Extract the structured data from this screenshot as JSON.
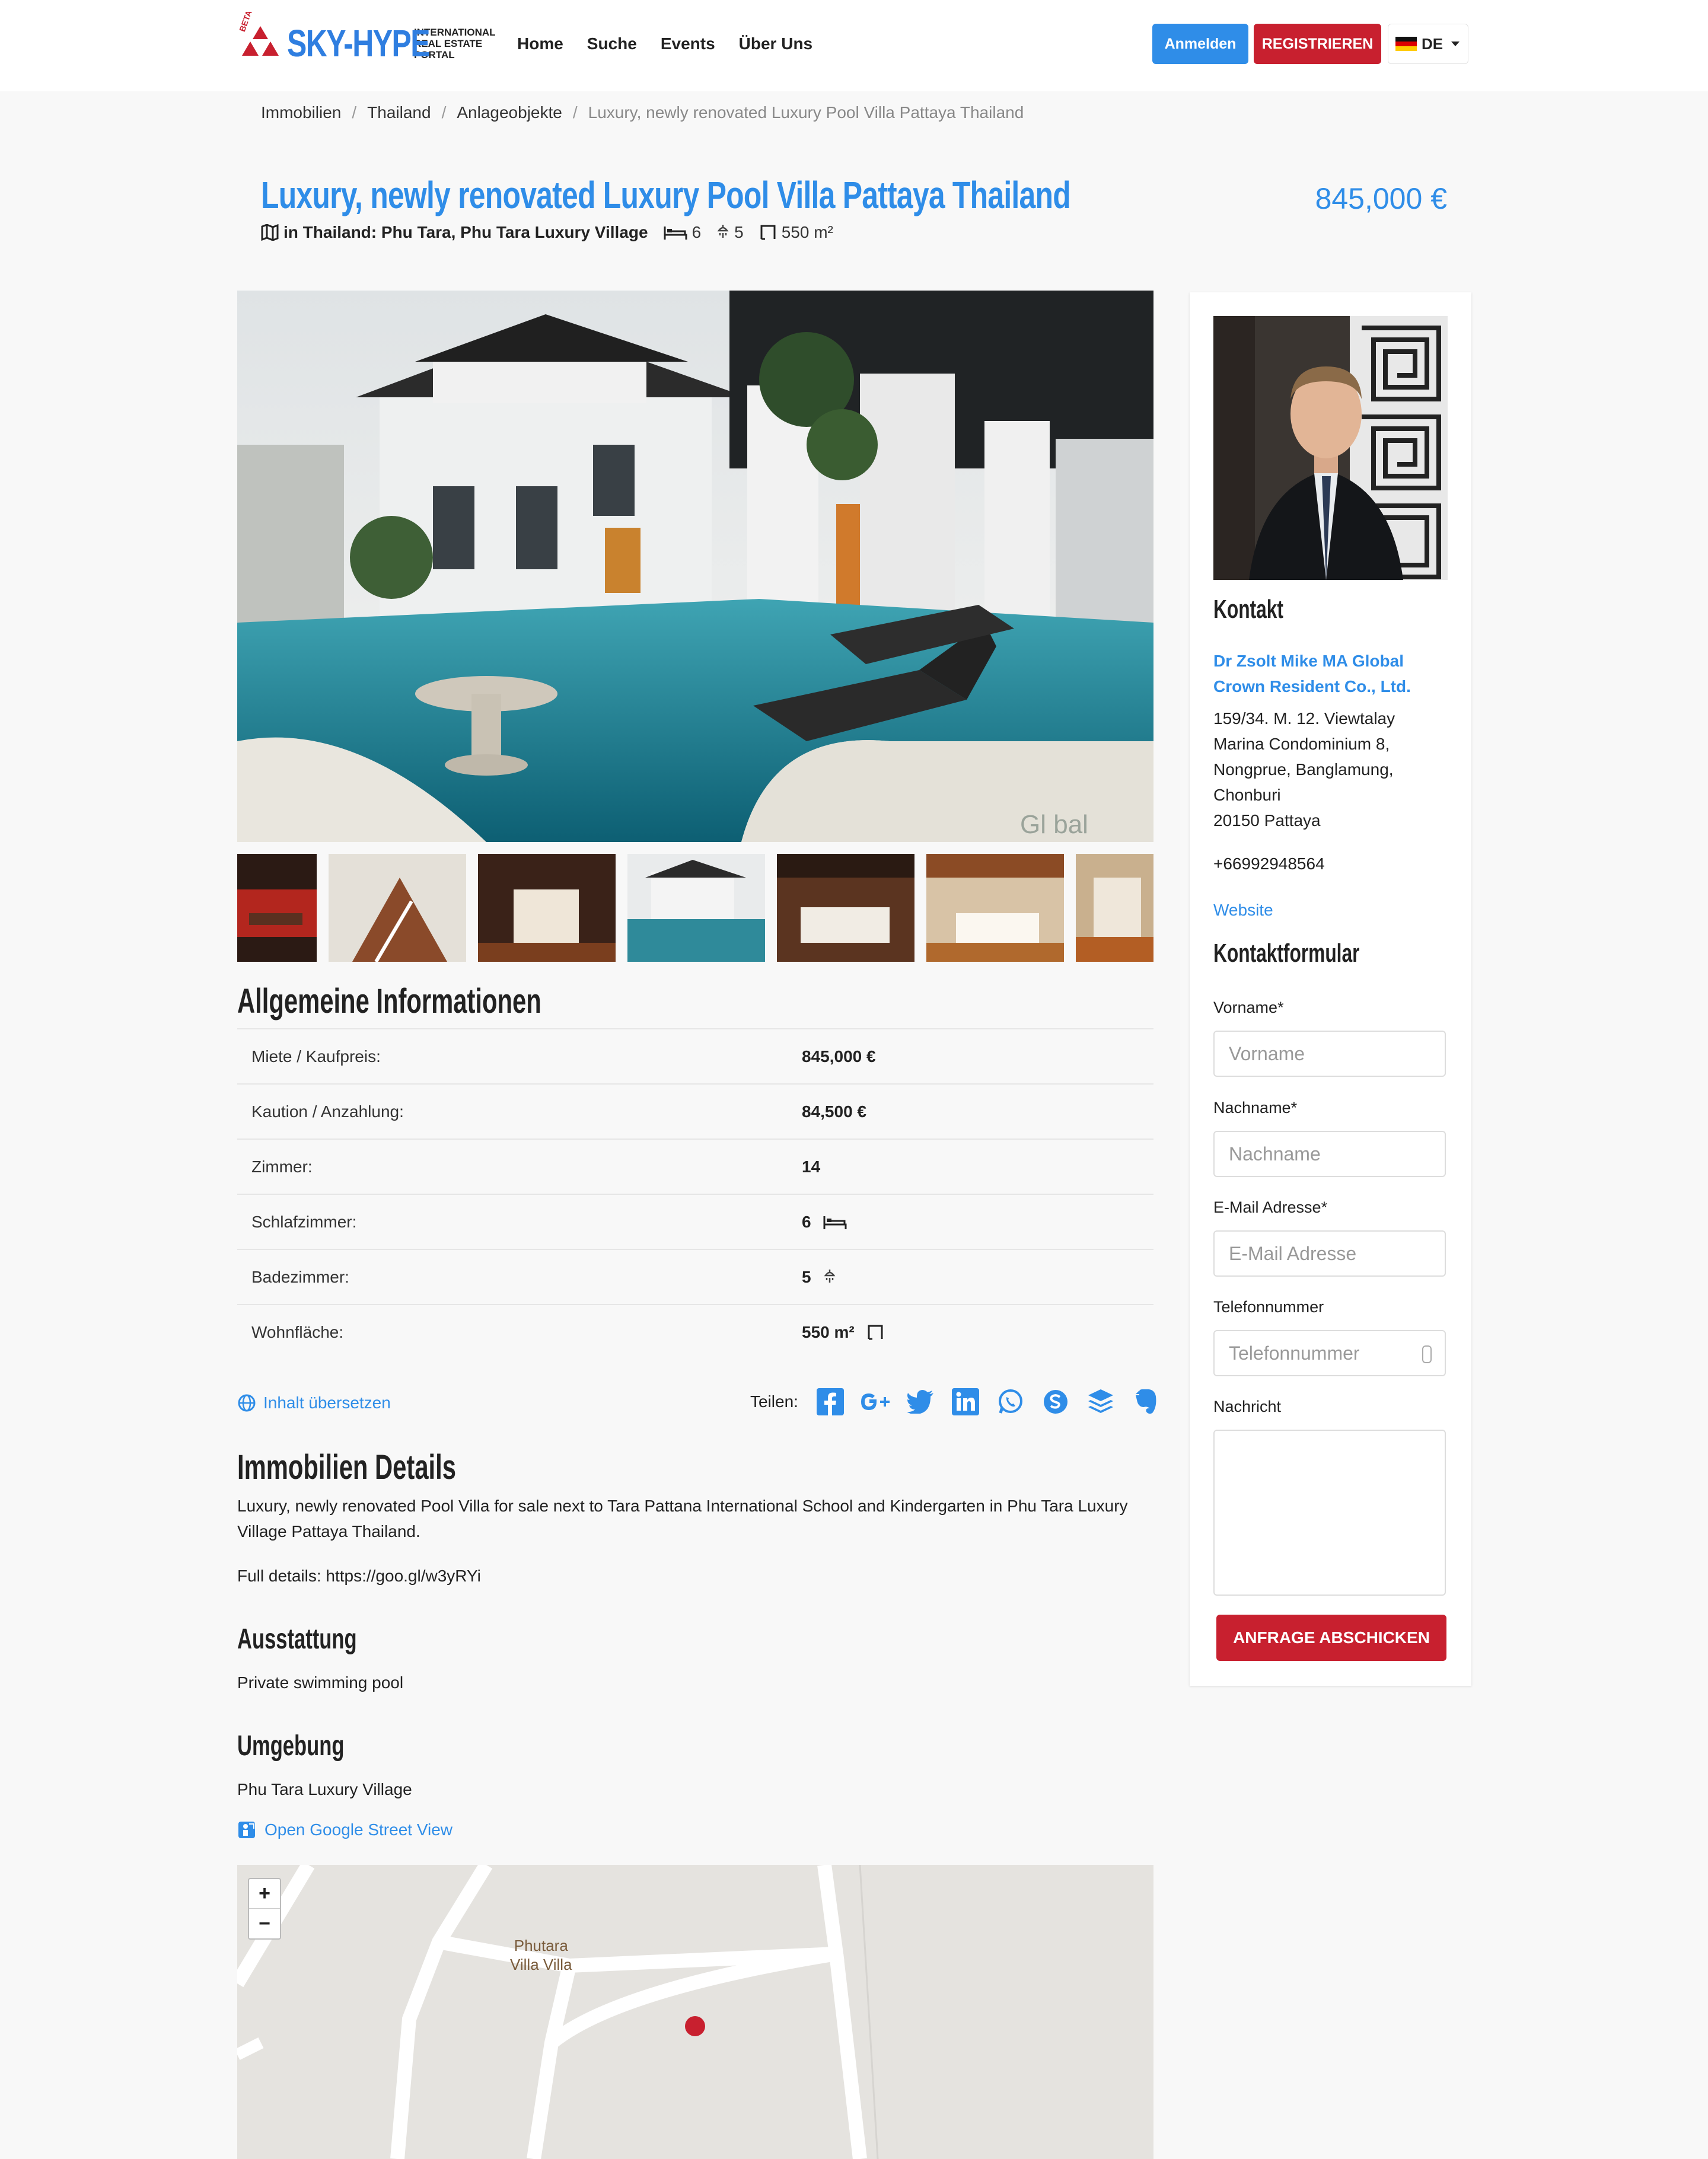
{
  "header": {
    "logo_badge": "BETA",
    "logo_name": "SKY-HYPE",
    "logo_sub": "INTERNATIONAL REAL ESTATE PORTAL",
    "nav": [
      "Home",
      "Suche",
      "Events",
      "Über Uns"
    ],
    "login": "Anmelden",
    "register": "REGISTRIEREN",
    "language": "DE"
  },
  "breadcrumb": [
    "Immobilien",
    "Thailand",
    "Anlageobjekte",
    "Luxury, newly renovated Luxury Pool Villa Pattaya Thailand"
  ],
  "listing": {
    "title": "Luxury, newly renovated Luxury Pool Villa Pattaya Thailand",
    "location": "in Thailand: Phu Tara, Phu Tara Luxury Village",
    "bedrooms": "6",
    "bathrooms": "5",
    "area": "550 m²",
    "price": "845,000 €",
    "photo_watermark": "Gl bal"
  },
  "general": {
    "heading": "Allgemeine Informationen",
    "rows": [
      {
        "label": "Miete / Kaufpreis:",
        "value": "845,000 €",
        "icon": ""
      },
      {
        "label": "Kaution / Anzahlung:",
        "value": "84,500 €",
        "icon": ""
      },
      {
        "label": "Zimmer:",
        "value": "14",
        "icon": ""
      },
      {
        "label": "Schlafzimmer:",
        "value": "6",
        "icon": "bed-icon"
      },
      {
        "label": "Badezimmer:",
        "value": "5",
        "icon": "shower-icon"
      },
      {
        "label": "Wohnfläche:",
        "value": "550 m²",
        "icon": "area-icon"
      }
    ]
  },
  "translate_label": "Inhalt übersetzen",
  "share": {
    "label": "Teilen:",
    "icons": [
      "facebook-icon",
      "google-plus-icon",
      "twitter-icon",
      "linkedin-icon",
      "whatsapp-icon",
      "skype-icon",
      "buffer-icon",
      "evernote-icon"
    ]
  },
  "details": {
    "heading": "Immobilien Details",
    "text": "Luxury, newly renovated Pool Villa for sale next to Tara Pattana International School and Kindergarten in Phu Tara Luxury Village Pattaya Thailand.",
    "full": "Full details: https://goo.gl/w3yRYi"
  },
  "equipment": {
    "heading": "Ausstattung",
    "text": "Private swimming pool"
  },
  "surroundings": {
    "heading": "Umgebung",
    "text": "Phu Tara Luxury Village"
  },
  "streetview_label": "Open Google Street View",
  "map": {
    "label_line1": "Phutara",
    "label_line2": "Villa Villa",
    "zoom_in": "+",
    "zoom_out": "−"
  },
  "sidebar": {
    "contact_heading": "Kontakt",
    "company": "Dr Zsolt Mike MA Global Crown Resident Co., Ltd.",
    "address_lines": [
      "159/34. M. 12. Viewtalay",
      "Marina Condominium 8,",
      "Nongprue, Banglamung,",
      "Chonburi",
      "20150 Pattaya"
    ],
    "phone": "+66992948564",
    "website": "Website",
    "form_heading": "Kontaktformular",
    "firstname_label": "Vorname*",
    "firstname_placeholder": "Vorname",
    "lastname_label": "Nachname*",
    "lastname_placeholder": "Nachname",
    "email_label": "E-Mail Adresse*",
    "email_placeholder": "E-Mail Adresse",
    "phone_label": "Telefonnummer",
    "phone_placeholder": "Telefonnummer",
    "message_label": "Nachricht",
    "submit": "ANFRAGE ABSCHICKEN"
  },
  "colors": {
    "brand_blue": "#2f8de8",
    "brand_red": "#c8202f"
  }
}
